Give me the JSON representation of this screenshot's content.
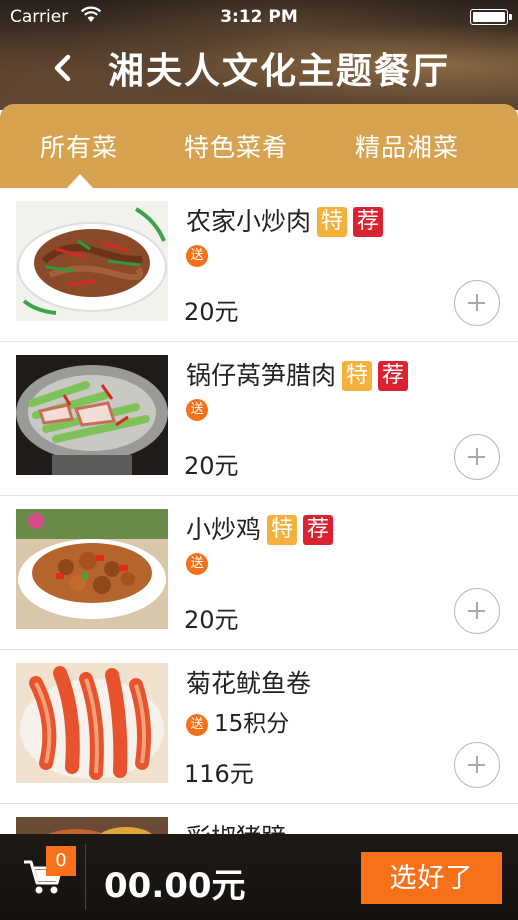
{
  "status_bar": {
    "carrier": "Carrier",
    "time": "3:12 PM"
  },
  "header": {
    "title": "湘夫人文化主题餐厅"
  },
  "tabs": [
    {
      "label": "所有菜",
      "selected": true
    },
    {
      "label": "特色菜肴",
      "selected": false
    },
    {
      "label": "精品湘菜",
      "selected": false
    }
  ],
  "dishes": [
    {
      "name": "农家小炒肉",
      "tag_special": "特",
      "tag_recommend": "荐",
      "gift_icon": "送",
      "gift_points": "",
      "price": "20元"
    },
    {
      "name": "锅仔莴笋腊肉",
      "tag_special": "特",
      "tag_recommend": "荐",
      "gift_icon": "送",
      "gift_points": "",
      "price": "20元"
    },
    {
      "name": "小炒鸡",
      "tag_special": "特",
      "tag_recommend": "荐",
      "gift_icon": "送",
      "gift_points": "",
      "price": "20元"
    },
    {
      "name": "菊花鱿鱼卷",
      "tag_special": "",
      "tag_recommend": "",
      "gift_icon": "送",
      "gift_points": "15积分",
      "price": "116元"
    },
    {
      "name": "彩椒猪蹄",
      "tag_special": "",
      "tag_recommend": "",
      "gift_icon": "",
      "gift_points": "",
      "price": ""
    }
  ],
  "footer": {
    "cart_count": "0",
    "total": "00.00元",
    "submit_label": "选好了"
  },
  "colors": {
    "tab_bar": "#d7a350",
    "accent": "#f7701a",
    "tag_special": "#f4b13b",
    "tag_recommend": "#dc2231"
  },
  "icons": {
    "back": "chevron-left-icon",
    "cart": "cart-icon",
    "add": "plus-circle-icon",
    "wifi": "wifi-icon",
    "battery": "battery-icon"
  }
}
